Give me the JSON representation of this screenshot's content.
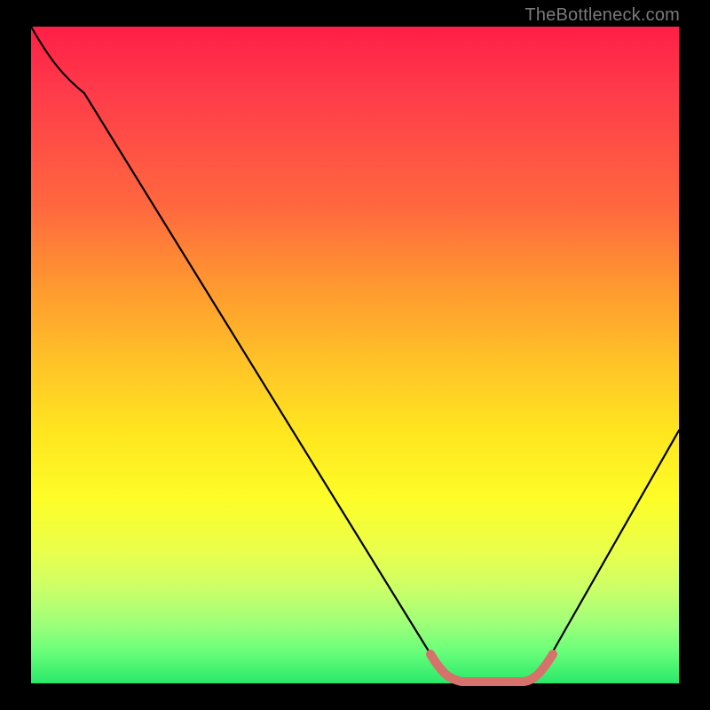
{
  "watermark": "TheBottleneck.com",
  "chart_data": {
    "type": "line",
    "title": "",
    "xlabel": "",
    "ylabel": "",
    "xlim": [
      0,
      100
    ],
    "ylim": [
      0,
      100
    ],
    "grid": false,
    "legend": false,
    "series": [
      {
        "name": "bottleneck-v-curve",
        "color": "#000000",
        "x": [
          0,
          5,
          10,
          20,
          30,
          40,
          50,
          58,
          62,
          66,
          70,
          74,
          78,
          85,
          92,
          100
        ],
        "values": [
          100,
          96,
          92,
          78,
          63,
          48,
          33,
          18,
          9,
          3,
          1,
          1,
          3,
          9,
          20,
          38
        ]
      },
      {
        "name": "optimal-range-highlight",
        "color": "#d6716c",
        "x": [
          62,
          66,
          70,
          74,
          78
        ],
        "values": [
          3,
          1,
          1,
          1,
          3
        ]
      }
    ],
    "annotations": []
  }
}
